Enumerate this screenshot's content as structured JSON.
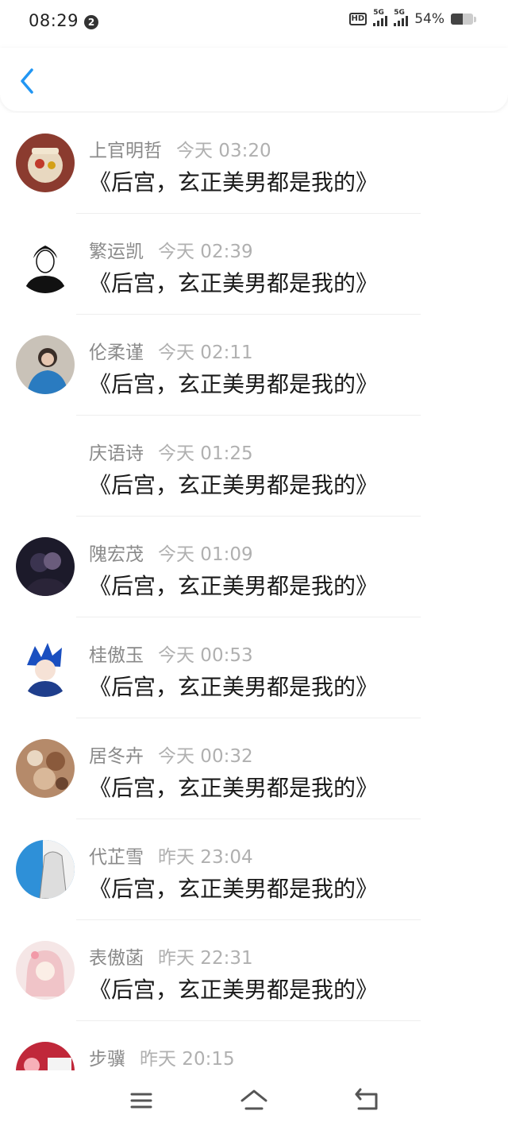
{
  "status_bar": {
    "time": "08:29",
    "notification_count": "2",
    "hd_label": "HD",
    "signal_1_label": "5G",
    "signal_2_label": "5G",
    "battery_percent": "54%",
    "battery_level": 0.54
  },
  "header": {
    "back_icon": "chevron-left-icon"
  },
  "items": [
    {
      "name": "上官明哲",
      "time": "今天 03:20",
      "message": "《后宫，玄正美男都是我的》",
      "avatar": "avatar-toy"
    },
    {
      "name": "繁运凯",
      "time": "今天 02:39",
      "message": "《后宫，玄正美男都是我的》",
      "avatar": "avatar-sketch"
    },
    {
      "name": "伦柔谨",
      "time": "今天 02:11",
      "message": "《后宫，玄正美男都是我的》",
      "avatar": "avatar-photo"
    },
    {
      "name": "庆语诗",
      "time": "今天 01:25",
      "message": "《后宫，玄正美男都是我的》",
      "avatar": "none"
    },
    {
      "name": "隗宏茂",
      "time": "今天 01:09",
      "message": "《后宫，玄正美男都是我的》",
      "avatar": "avatar-dark"
    },
    {
      "name": "桂傲玉",
      "time": "今天 00:53",
      "message": "《后宫，玄正美男都是我的》",
      "avatar": "avatar-anime-blue"
    },
    {
      "name": "居冬卉",
      "time": "今天 00:32",
      "message": "《后宫，玄正美男都是我的》",
      "avatar": "avatar-shells"
    },
    {
      "name": "代芷雪",
      "time": "昨天 23:04",
      "message": "《后宫，玄正美男都是我的》",
      "avatar": "avatar-sketch-blue"
    },
    {
      "name": "表傲菡",
      "time": "昨天 22:31",
      "message": "《后宫，玄正美男都是我的》",
      "avatar": "avatar-anime-pink"
    },
    {
      "name": "步骥",
      "time": "昨天 20:15",
      "message": "",
      "avatar": "avatar-red"
    }
  ],
  "nav_bar": {
    "menu_icon": "menu-icon",
    "home_icon": "home-icon",
    "back_icon": "back-icon"
  },
  "colors": {
    "name_gray": "#8a8a8a",
    "time_gray": "#b0b0b0",
    "back_blue": "#2196f3"
  }
}
